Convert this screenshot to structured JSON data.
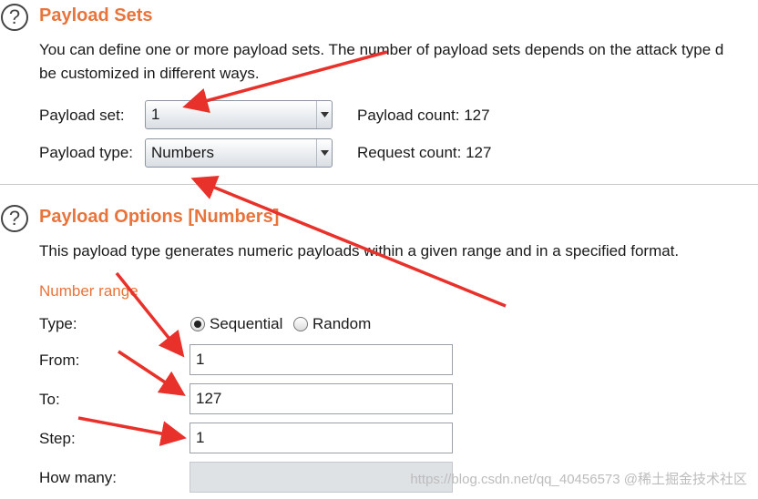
{
  "payload_sets": {
    "title": "Payload Sets",
    "description_line1": "You can define one or more payload sets. The number of payload sets depends on the attack type d",
    "description_line2": "be customized in different ways.",
    "set_label": "Payload set:",
    "set_value": "1",
    "type_label": "Payload type:",
    "type_value": "Numbers",
    "payload_count_label": "Payload count:",
    "payload_count_value": "127",
    "request_count_label": "Request count:",
    "request_count_value": "127"
  },
  "payload_options": {
    "title": "Payload Options [Numbers]",
    "description": "This payload type generates numeric payloads within a given range and in a specified format.",
    "number_range_heading": "Number range",
    "type_label": "Type:",
    "radio_sequential": "Sequential",
    "radio_random": "Random",
    "selected_type": "Sequential",
    "from_label": "From:",
    "from_value": "1",
    "to_label": "To:",
    "to_value": "127",
    "step_label": "Step:",
    "step_value": "1",
    "how_many_label": "How many:",
    "how_many_value": ""
  },
  "icons": {
    "help": "?",
    "dropdown": "chevron-down-icon"
  },
  "colors": {
    "accent": "#e8743b",
    "annotation_arrow": "#e8312a"
  },
  "watermark": "https://blog.csdn.net/qq_40456573 @稀土掘金技术社区"
}
